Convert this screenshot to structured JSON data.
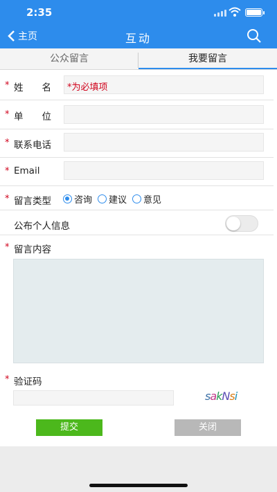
{
  "status": {
    "time": "2:35"
  },
  "nav": {
    "back_label": "主页",
    "title": "互动"
  },
  "tabs": [
    {
      "label": "公众留言"
    },
    {
      "label": "我要留言"
    }
  ],
  "form": {
    "name": {
      "label": "姓　　名",
      "placeholder": "*为必填项"
    },
    "unit": {
      "label": "单　　位"
    },
    "phone": {
      "label": "联系电话"
    },
    "email": {
      "label": "Email"
    },
    "type": {
      "label": "留言类型",
      "options": [
        "咨询",
        "建议",
        "意见"
      ],
      "selected": "咨询"
    },
    "publish": {
      "label": "公布个人信息",
      "enabled": false
    },
    "content": {
      "label": "留言内容"
    },
    "captcha": {
      "label": "验证码",
      "code": "sakNsi"
    },
    "submit_label": "提交",
    "close_label": "关闭"
  },
  "colors": {
    "accent": "#2d8cec",
    "required": "#d0021b",
    "submit": "#4cb81c",
    "close": "#b8b8b8"
  }
}
